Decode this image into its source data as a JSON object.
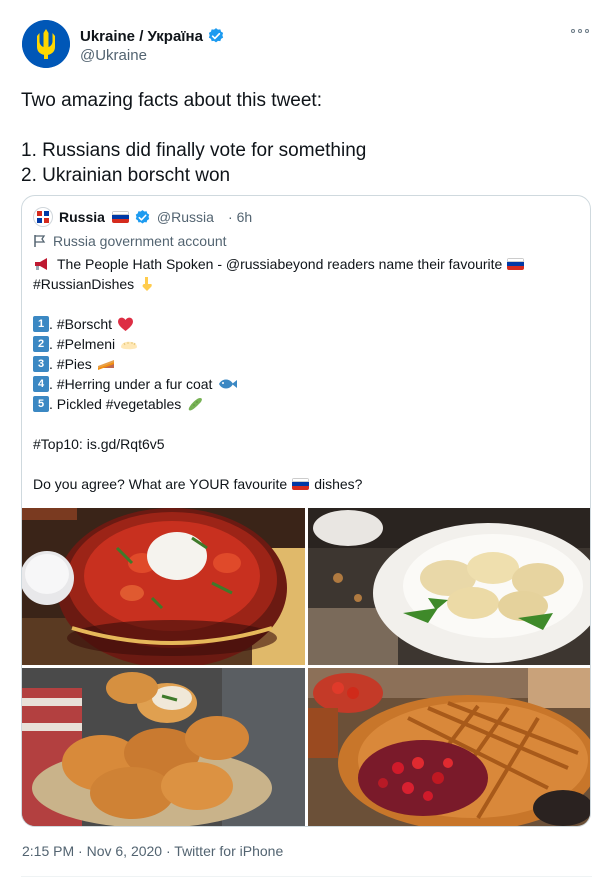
{
  "author": {
    "name": "Ukraine / Україна",
    "handle": "@Ukraine",
    "verified": true,
    "avatar_icon": "trident-icon",
    "avatar_color": "#0057b7"
  },
  "tweet": {
    "lines": [
      "Two amazing facts about this tweet:",
      "",
      "1. Russians did finally vote for something",
      "2. Ukrainian borscht won"
    ]
  },
  "quoted": {
    "name": "Russia",
    "handle": "@Russia",
    "separator": "·",
    "time": "6h",
    "label": "Russia government account",
    "intro_line1": "The People Hath Spoken - @russiabeyond readers name their favourite",
    "intro_line2": "#RussianDishes",
    "list": [
      {
        "num": "1",
        "text": ". #Borscht",
        "emoji": "heart-icon"
      },
      {
        "num": "2",
        "text": ". #Pelmeni",
        "emoji": "dumpling-icon"
      },
      {
        "num": "3",
        "text": ". #Pies",
        "emoji": "pie-icon"
      },
      {
        "num": "4",
        "text": ". #Herring under a fur coat",
        "emoji": "fish-icon"
      },
      {
        "num": "5",
        "text": ". Pickled #vegetables",
        "emoji": "cucumber-icon"
      }
    ],
    "top10": "#Top10: is.gd/Rqt6v5",
    "question_before": "Do you agree? What are YOUR favourite",
    "question_after": "dishes?",
    "photos": [
      "borscht-photo",
      "pelmeni-photo",
      "pirozhki-photo",
      "berry-pie-photo"
    ]
  },
  "meta": {
    "time": "2:15 PM",
    "dot1": "·",
    "date": "Nov 6, 2020",
    "dot2": "·",
    "source": "Twitter for iPhone"
  },
  "colors": {
    "verified": "#1d9bf0",
    "keycap": "#3b88c3",
    "muted": "#536471"
  }
}
